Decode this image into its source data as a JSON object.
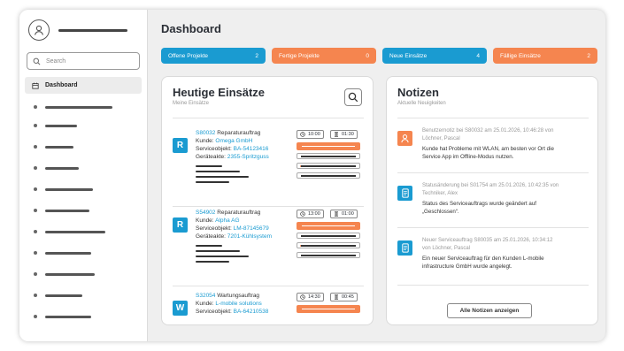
{
  "sidebar": {
    "search_placeholder": "Search",
    "active_item": "Dashboard",
    "placeholder_items": 11
  },
  "header": {
    "title": "Dashboard"
  },
  "tiles": [
    {
      "label": "Offene Projekte",
      "count": "2",
      "color": "#1a9bd1"
    },
    {
      "label": "Fertige Projekte",
      "count": "0",
      "color": "#f5854f"
    },
    {
      "label": "Neue Einsätze",
      "count": "4",
      "color": "#1a9bd1"
    },
    {
      "label": "Fällige Einsätze",
      "count": "2",
      "color": "#f5854f"
    }
  ],
  "jobs_panel": {
    "title": "Heutige Einsätze",
    "subtitle": "Meine Einsätze",
    "jobs": [
      {
        "badge": "R",
        "number": "S80032",
        "type": "Reparaturauftrag",
        "kunde_label": "Kunde:",
        "kunde": "Omega GmbH",
        "objekt_label": "Serviceobjekt:",
        "objekt": "BA-54123416",
        "geraet_label": "Geräteakte:",
        "geraet": "2355-Spritzguss",
        "time": "10:00",
        "duration": "01:30"
      },
      {
        "badge": "R",
        "number": "S54902",
        "type": "Reparaturauftrag",
        "kunde_label": "Kunde:",
        "kunde": "Alpha AG",
        "objekt_label": "Serviceobjekt:",
        "objekt": "LM-87145679",
        "geraet_label": "Geräteakte:",
        "geraet": "7201-Kühlsystem",
        "time": "13:00",
        "duration": "01:00"
      },
      {
        "badge": "W",
        "number": "S32054",
        "type": "Wartungsauftrag",
        "kunde_label": "Kunde:",
        "kunde": "L-mobile solutions",
        "objekt_label": "Serviceobjekt:",
        "objekt": "BA-64210538",
        "time": "14:30",
        "duration": "00:45"
      }
    ]
  },
  "notes_panel": {
    "title": "Notizen",
    "subtitle": "Aktuelle Neuigkeiten",
    "notes": [
      {
        "icon": "user-icon",
        "color": "#f5854f",
        "head1": "Benutzernotiz bei S80032 am 25.01.2026, 10:46:28 von",
        "head2": "Löchner, Pascal",
        "body1": "Kunde hat Probleme mit WLAN, am besten vor Ort die",
        "body2": "Service App im Offline-Modus nutzen.",
        "body3": ""
      },
      {
        "icon": "document-icon",
        "color": "#1a9bd1",
        "head1": "Statusänderung bei S01754 am 25.01.2026, 10:42:35 von",
        "head2": "Techniker, Alex",
        "body1": "Status des Serviceauftrags wurde geändert auf",
        "body2": "„Geschlossen“.",
        "body3": ""
      },
      {
        "icon": "document-icon",
        "color": "#1a9bd1",
        "head1": "Neuer Serviceauftrag S80035 am 25.01.2026, 10:34:12",
        "head2": "von Löchner, Pascal",
        "body1": "Ein neuer Serviceauftrag für den Kunden L-mobile",
        "body2": "infrastructure GmbH wurde angelegt.",
        "body3": ""
      }
    ],
    "button": "Alle Notizen anzeigen"
  }
}
